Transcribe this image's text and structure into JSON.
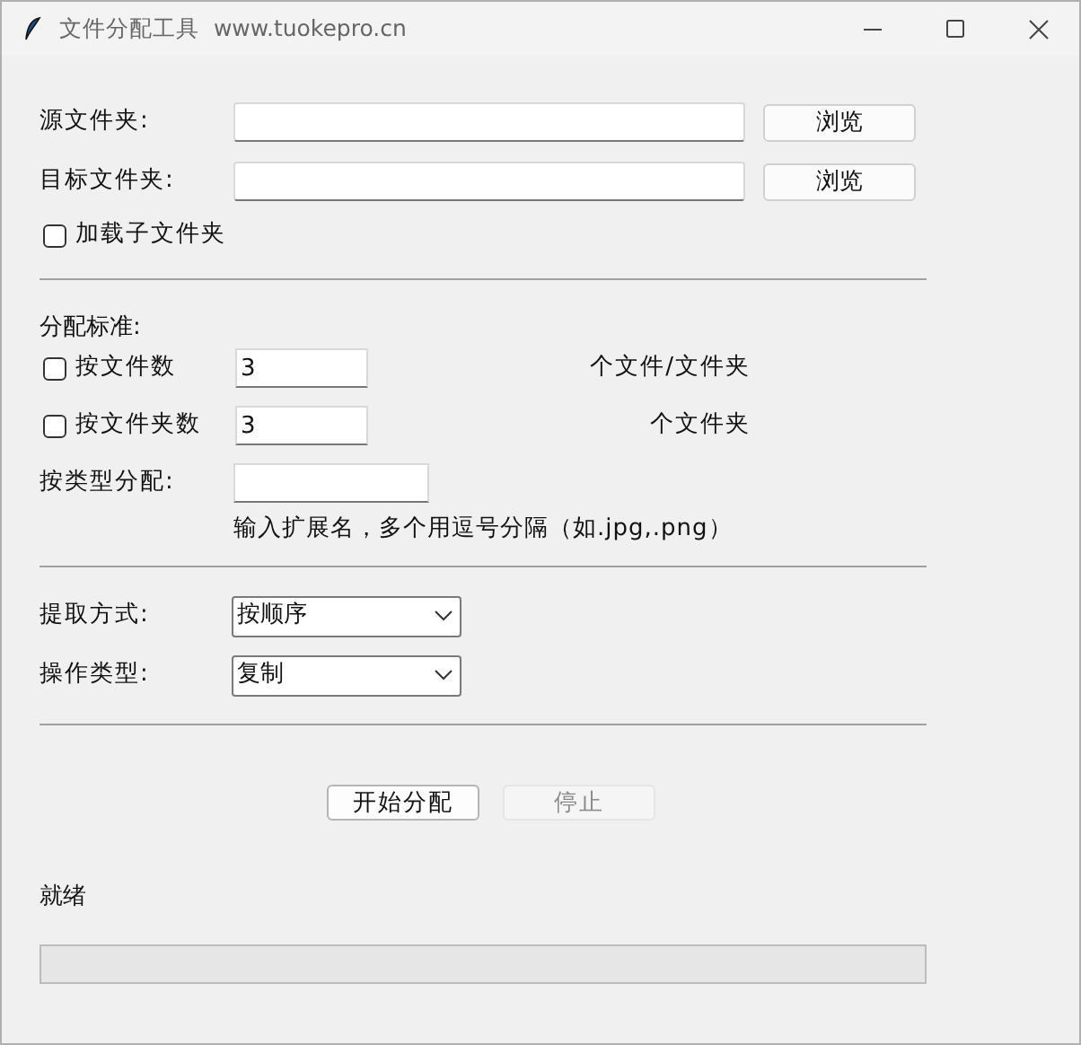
{
  "window": {
    "title": "文件分配工具  www.tuokepro.cn"
  },
  "folders": [
    {
      "label": "源文件夹:",
      "button": "浏览"
    },
    {
      "label": "目标文件夹:",
      "button": "浏览"
    }
  ],
  "include_subfolders": {
    "label": "加载子文件夹",
    "checked": false
  },
  "criteria": {
    "heading": "分配标准:",
    "rows": [
      {
        "kind": "checkbox",
        "label": "按文件数",
        "checked": false,
        "value": "3",
        "unit": "个文件/文件夹"
      },
      {
        "kind": "checkbox",
        "label": "按文件夹数",
        "checked": false,
        "value": "3",
        "unit": "个文件夹"
      },
      {
        "kind": "text",
        "label": "按类型分配:",
        "hint": "输入扩展名，多个用逗号分隔（如.jpg,.png）"
      }
    ]
  },
  "options": [
    {
      "label": "提取方式:",
      "value": "按顺序"
    },
    {
      "label": "操作类型:",
      "value": "复制"
    }
  ],
  "buttons": [
    {
      "label": "开始分配",
      "disabled": false
    },
    {
      "label": "停止",
      "disabled": true
    }
  ],
  "status": "就绪",
  "progress": {
    "level": 0
  }
}
